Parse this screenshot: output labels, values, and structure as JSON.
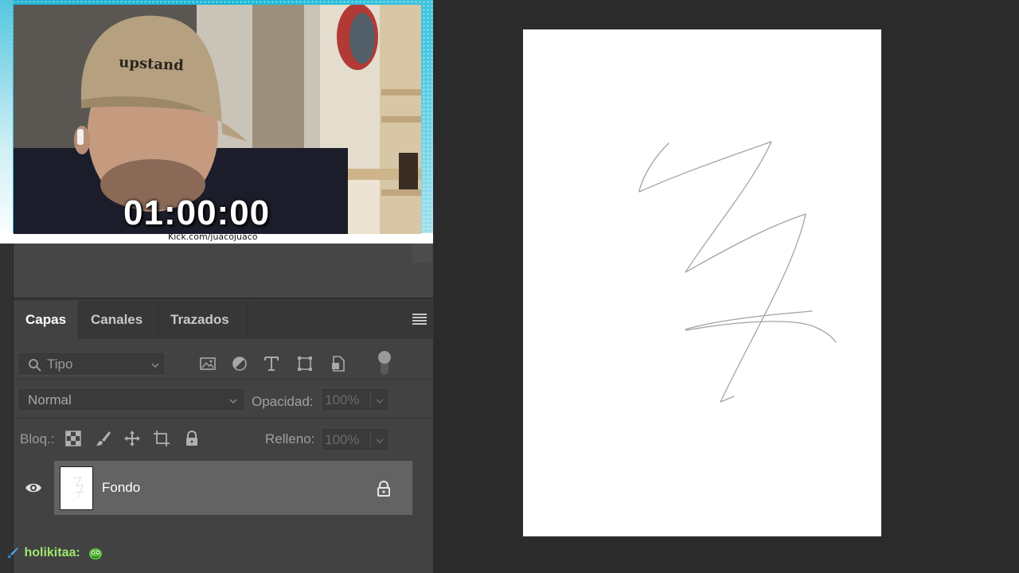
{
  "stream": {
    "timer": "01:00:00",
    "channel_url": "Kick.com/juacojuaco",
    "cap_text": "upstand"
  },
  "layers_panel": {
    "tabs": [
      {
        "label": "Capas",
        "active": true
      },
      {
        "label": "Canales",
        "active": false
      },
      {
        "label": "Trazados",
        "active": false
      }
    ],
    "filter": {
      "label": "Tipo",
      "icons": [
        "image-filter-icon",
        "adjustment-filter-icon",
        "type-filter-icon",
        "shape-filter-icon",
        "smart-object-filter-icon"
      ]
    },
    "blend_mode": "Normal",
    "opacity_label": "Opacidad:",
    "opacity_value": "100%",
    "lock_label": "Bloq.:",
    "lock_icons": [
      "lock-transparent-icon",
      "lock-image-icon",
      "lock-position-icon",
      "lock-artboard-icon",
      "lock-all-icon"
    ],
    "fill_label": "Relleno:",
    "fill_value": "100%",
    "layers": [
      {
        "name": "Fondo",
        "visible": true,
        "locked": true
      }
    ]
  },
  "chat": {
    "username": "holikitaa:",
    "badge": "sword-badge-icon",
    "emote": "green-blob-emote-icon",
    "username_color": "#9ee86f"
  },
  "colors": {
    "panel_bg": "#424242",
    "workspace_bg": "#2b2b2b",
    "selected_layer": "#636363",
    "frame_accent": "#22b0d4"
  }
}
